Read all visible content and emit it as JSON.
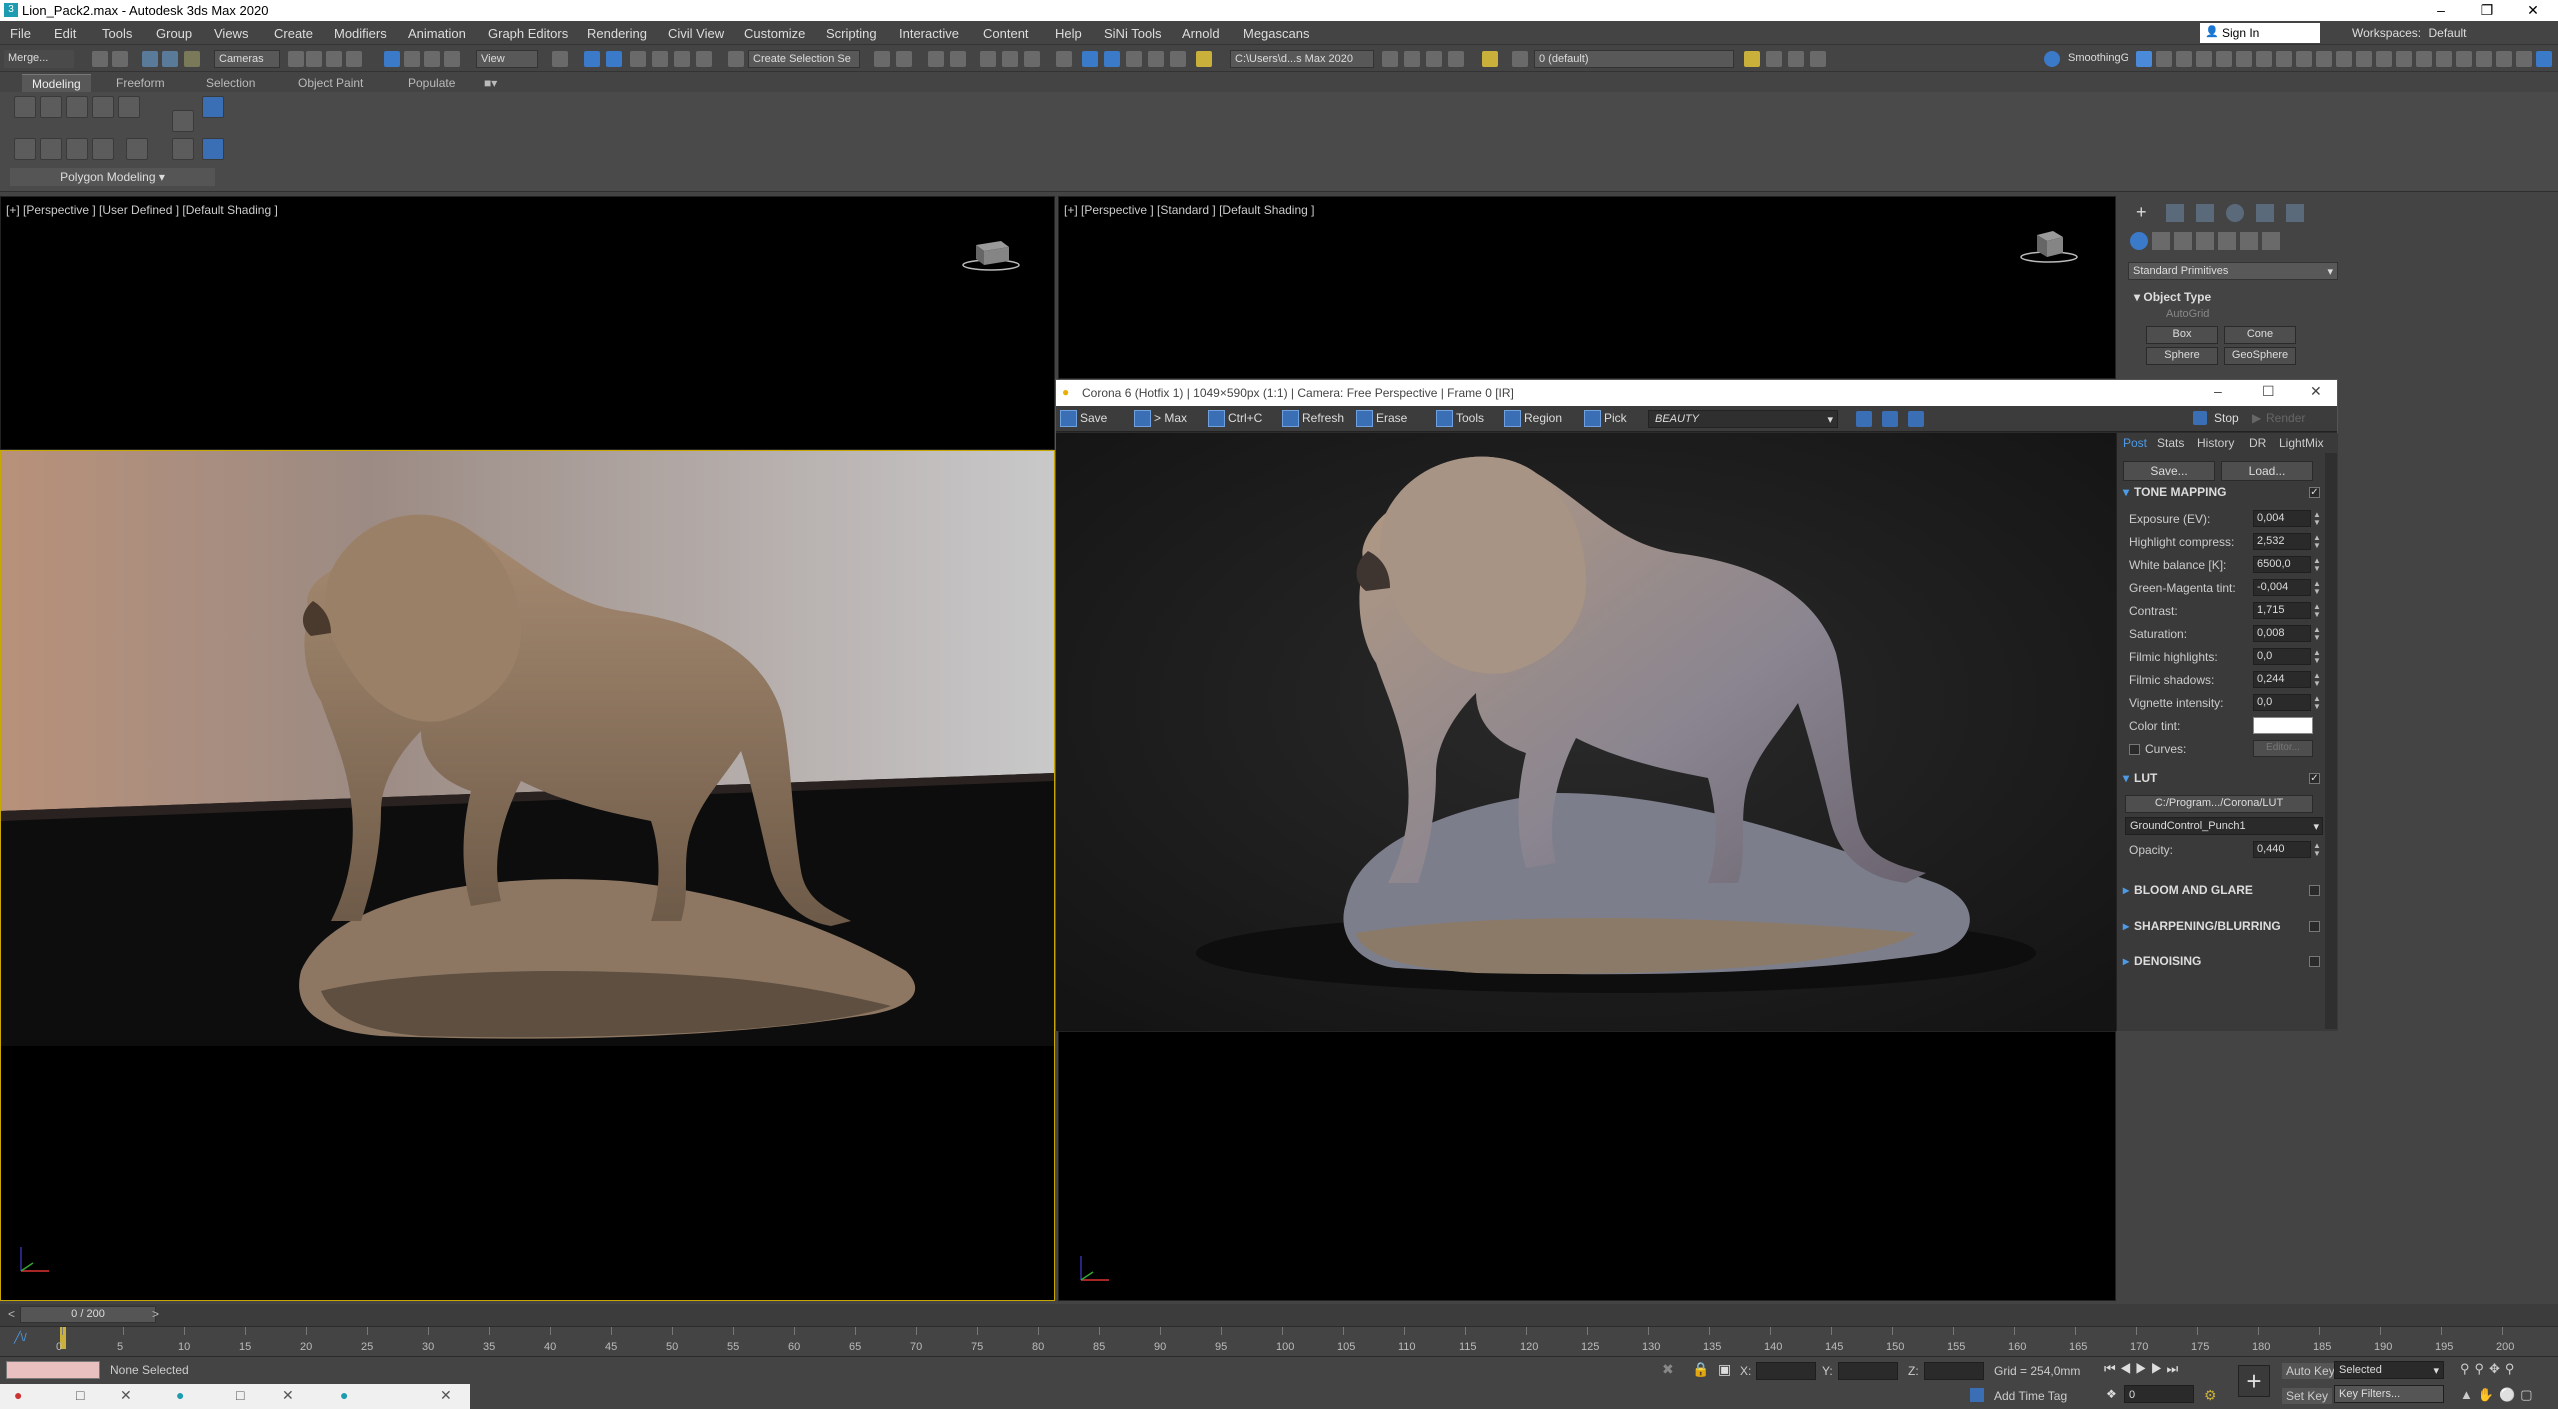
{
  "window": {
    "title": "Lion_Pack2.max - Autodesk 3ds Max 2020",
    "app_icon": "3"
  },
  "menu": [
    "File",
    "Edit",
    "Tools",
    "Group",
    "Views",
    "Create",
    "Modifiers",
    "Animation",
    "Graph Editors",
    "Rendering",
    "Civil View",
    "Customize",
    "Scripting",
    "Interactive",
    "Content",
    "Help",
    "SiNi Tools",
    "Arnold",
    "Megascans"
  ],
  "account": {
    "signin": "Sign In",
    "workspaces_label": "Workspaces:",
    "workspaces_value": "Default"
  },
  "toolbar": {
    "merge": "Merge...",
    "cameras": "Cameras",
    "view_dropdown": "View",
    "selection_set": "Create Selection Se",
    "path": "C:\\Users\\d...s Max 2020",
    "layer": "0 (default)",
    "smoothing": "SmoothingGro"
  },
  "ribbon": {
    "tabs": [
      "Modeling",
      "Freeform",
      "Selection",
      "Object Paint",
      "Populate"
    ],
    "panel_label": "Polygon Modeling"
  },
  "viewports": {
    "top_left": "[+] [Perspective ] [User Defined ] [Default Shading ]",
    "top_right": "[+] [Perspective ] [Standard ] [Default Shading ]"
  },
  "vfb": {
    "title": "Corona 6 (Hotfix 1) | 1049×590px (1:1) | Camera: Free Perspective | Frame 0 [IR]",
    "buttons": [
      "Save",
      "> Max",
      "Ctrl+C",
      "Refresh",
      "Erase",
      "Tools",
      "Region",
      "Pick"
    ],
    "channel": "BEAUTY",
    "stop": "Stop",
    "render": "Render",
    "tabs": [
      "Post",
      "Stats",
      "History",
      "DR",
      "LightMix"
    ],
    "save": "Save...",
    "load": "Load...",
    "tone_mapping": {
      "header": "TONE MAPPING",
      "params": [
        {
          "label": "Exposure (EV):",
          "value": "0,004"
        },
        {
          "label": "Highlight compress:",
          "value": "2,532"
        },
        {
          "label": "White balance [K]:",
          "value": "6500,0"
        },
        {
          "label": "Green-Magenta tint:",
          "value": "-0,004"
        },
        {
          "label": "Contrast:",
          "value": "1,715"
        },
        {
          "label": "Saturation:",
          "value": "0,008"
        },
        {
          "label": "Filmic highlights:",
          "value": "0,0"
        },
        {
          "label": "Filmic shadows:",
          "value": "0,244"
        },
        {
          "label": "Vignette intensity:",
          "value": "0,0"
        }
      ],
      "color_tint": "Color tint:",
      "curves": "Curves:",
      "editor": "Editor..."
    },
    "lut": {
      "header": "LUT",
      "path": "C:/Program.../Corona/LUT",
      "preset": "GroundControl_Punch1",
      "opacity_label": "Opacity:",
      "opacity_value": "0,440"
    },
    "collapsed_sections": [
      "BLOOM AND GLARE",
      "SHARPENING/BLURRING",
      "DENOISING"
    ]
  },
  "command_panel": {
    "category": "Standard Primitives",
    "object_type": "Object Type",
    "autogrid": "AutoGrid",
    "buttons": [
      "Box",
      "Cone",
      "Sphere",
      "GeoSphere"
    ]
  },
  "timeline": {
    "frame_display": "0 / 200",
    "ticks": [
      "0",
      "5",
      "10",
      "15",
      "20",
      "25",
      "30",
      "35",
      "40",
      "45",
      "50",
      "55",
      "60",
      "65",
      "70",
      "75",
      "80",
      "85",
      "90",
      "95",
      "100",
      "105",
      "110",
      "115",
      "120",
      "125",
      "130",
      "135",
      "140",
      "145",
      "150",
      "155",
      "160",
      "165",
      "170",
      "175",
      "180",
      "185",
      "190",
      "195",
      "200"
    ]
  },
  "status": {
    "selection": "None Selected",
    "x_label": "X:",
    "y_label": "Y:",
    "z_label": "Z:",
    "grid": "Grid = 254,0mm",
    "add_time_tag": "Add Time Tag",
    "auto_key": "Auto Key",
    "set_key": "Set Key",
    "key_mode": "Selected",
    "key_filters": "Key Filters...",
    "frame_field": "0",
    "script_tag": "╱\\/"
  }
}
